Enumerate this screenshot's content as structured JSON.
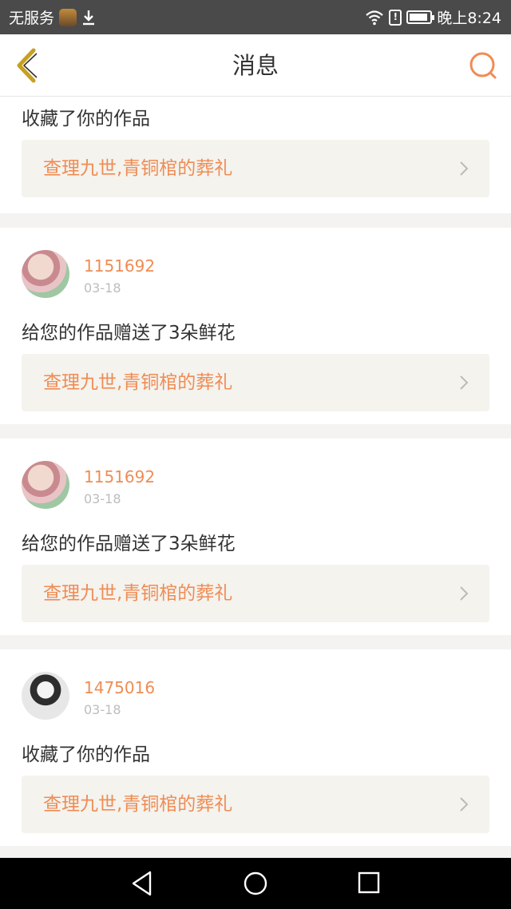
{
  "status_bar": {
    "carrier": "无服务",
    "time": "晚上8:24",
    "icons": [
      "app-icon",
      "download-icon",
      "wifi-icon",
      "alert-icon",
      "battery-icon"
    ]
  },
  "header": {
    "title": "消息",
    "back_icon": "chevron-left-icon",
    "search_icon": "search-icon",
    "accent_color": "#ef8c55",
    "back_color": "#c8a020"
  },
  "messages": [
    {
      "action": "收藏了你的作品",
      "work_title": "查理九世,青铜棺的葬礼"
    },
    {
      "username": "1151692",
      "date": "03-18",
      "action": "给您的作品赠送了3朵鲜花",
      "work_title": "查理九世,青铜棺的葬礼"
    },
    {
      "username": "1151692",
      "date": "03-18",
      "action": "给您的作品赠送了3朵鲜花",
      "work_title": "查理九世,青铜棺的葬礼"
    },
    {
      "username": "1475016",
      "date": "03-18",
      "action": "收藏了你的作品",
      "work_title": "查理九世,青铜棺的葬礼"
    }
  ],
  "nav_bar": {
    "icons": [
      "back-triangle-icon",
      "home-circle-icon",
      "recent-square-icon"
    ]
  }
}
